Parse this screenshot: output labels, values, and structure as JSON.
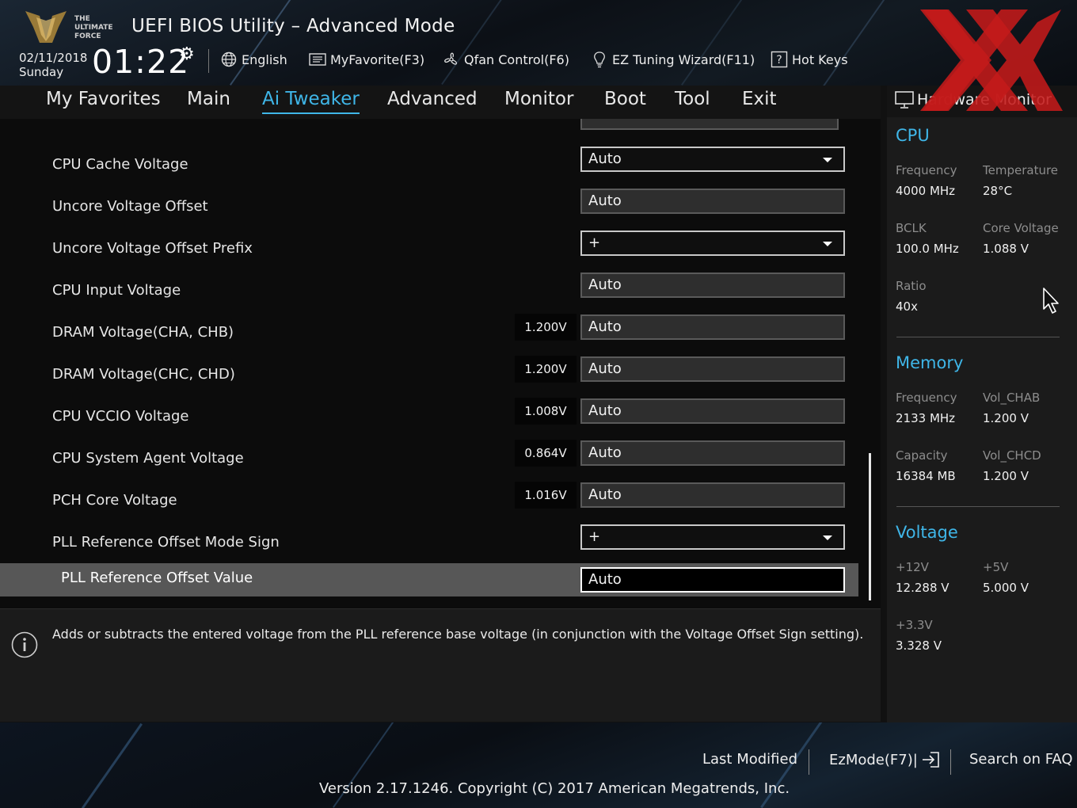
{
  "header": {
    "title": "UEFI BIOS Utility – Advanced Mode",
    "logo_text": "THE ULTIMATE FORCE",
    "date": "02/11/2018",
    "day": "Sunday",
    "time": "01:22",
    "toolbar": [
      {
        "label": "English",
        "icon": "globe-icon"
      },
      {
        "label": "MyFavorite(F3)",
        "icon": "favorites-list-icon"
      },
      {
        "label": "Qfan Control(F6)",
        "icon": "fan-icon"
      },
      {
        "label": "EZ Tuning Wizard(F11)",
        "icon": "lightbulb-icon"
      },
      {
        "label": "Hot Keys",
        "icon": "question-box-icon"
      }
    ]
  },
  "nav": {
    "tabs": [
      "My Favorites",
      "Main",
      "Ai Tweaker",
      "Advanced",
      "Monitor",
      "Boot",
      "Tool",
      "Exit"
    ],
    "active": "Ai Tweaker"
  },
  "settings": [
    {
      "label": "CPU Cache Voltage",
      "value": "Auto",
      "type": "dropdown"
    },
    {
      "label": "Uncore Voltage Offset",
      "value": "Auto",
      "type": "text"
    },
    {
      "label": "Uncore Voltage Offset Prefix",
      "value": "+",
      "type": "dropdown"
    },
    {
      "label": "CPU Input Voltage",
      "value": "Auto",
      "type": "text"
    },
    {
      "label": "DRAM Voltage(CHA, CHB)",
      "value": "Auto",
      "badge": "1.200V",
      "type": "text"
    },
    {
      "label": "DRAM Voltage(CHC, CHD)",
      "value": "Auto",
      "badge": "1.200V",
      "type": "text"
    },
    {
      "label": "CPU VCCIO Voltage",
      "value": "Auto",
      "badge": "1.008V",
      "type": "text"
    },
    {
      "label": "CPU System Agent Voltage",
      "value": "Auto",
      "badge": "0.864V",
      "type": "text"
    },
    {
      "label": "PCH Core Voltage",
      "value": "Auto",
      "badge": "1.016V",
      "type": "text"
    },
    {
      "label": "PLL Reference Offset Mode Sign",
      "value": "+",
      "type": "dropdown"
    },
    {
      "label": "PLL Reference Offset Value",
      "value": "Auto",
      "type": "text",
      "selected": true
    }
  ],
  "help": {
    "text": "Adds or subtracts the entered voltage from the PLL reference base voltage (in conjunction with the Voltage Offset Sign setting)."
  },
  "hardware_monitor": {
    "title": "Hardware Monitor",
    "cpu": {
      "heading": "CPU",
      "frequency_label": "Frequency",
      "frequency": "4000 MHz",
      "temperature_label": "Temperature",
      "temperature": "28°C",
      "bclk_label": "BCLK",
      "bclk": "100.0 MHz",
      "core_voltage_label": "Core Voltage",
      "core_voltage": "1.088 V",
      "ratio_label": "Ratio",
      "ratio": "40x"
    },
    "memory": {
      "heading": "Memory",
      "frequency_label": "Frequency",
      "frequency": "2133 MHz",
      "vol_chab_label": "Vol_CHAB",
      "vol_chab": "1.200 V",
      "capacity_label": "Capacity",
      "capacity": "16384 MB",
      "vol_chcd_label": "Vol_CHCD",
      "vol_chcd": "1.200 V"
    },
    "voltage": {
      "heading": "Voltage",
      "v12_label": "+12V",
      "v12": "12.288 V",
      "v5_label": "+5V",
      "v5": "5.000 V",
      "v33_label": "+3.3V",
      "v33": "3.328 V"
    }
  },
  "footer": {
    "last_modified": "Last Modified",
    "ezmode": "EzMode(F7)|",
    "search_faq": "Search on FAQ",
    "version": "Version 2.17.1246. Copyright (C) 2017 American Megatrends, Inc."
  },
  "colors": {
    "accent": "#3fb6e8",
    "selected_row": "#575757",
    "watermark": "#c41a1a"
  }
}
